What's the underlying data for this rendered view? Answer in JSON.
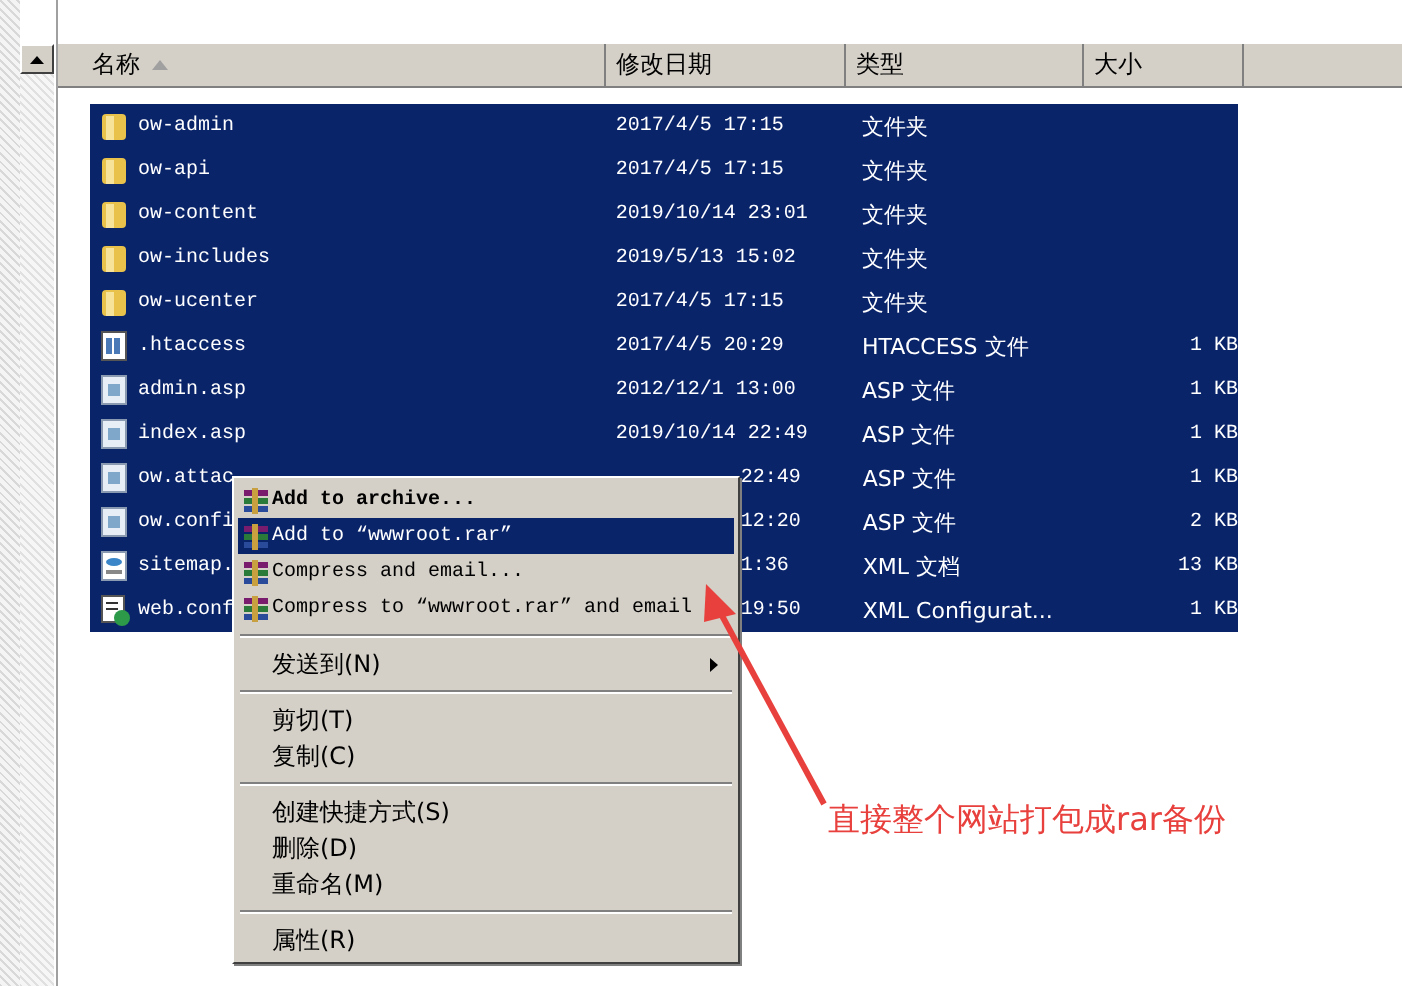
{
  "columns": [
    {
      "label": "名称",
      "sorted": true
    },
    {
      "label": "修改日期",
      "sorted": false
    },
    {
      "label": "类型",
      "sorted": false
    },
    {
      "label": "大小",
      "sorted": false
    }
  ],
  "rows": [
    {
      "kind": "folder",
      "name": "ow-admin",
      "date": "2017/4/5 17:15",
      "type": "文件夹",
      "selected": true
    },
    {
      "kind": "folder",
      "name": "ow-api",
      "date": "2017/4/5 17:15",
      "type": "文件夹",
      "selected": true
    },
    {
      "kind": "folder",
      "name": "ow-content",
      "date": "2019/10/14 23:01",
      "type": "文件夹",
      "selected": true
    },
    {
      "kind": "folder",
      "name": "ow-includes",
      "date": "2019/5/13 15:02",
      "type": "文件夹",
      "selected": true
    },
    {
      "kind": "folder",
      "name": "ow-ucenter",
      "date": "2017/4/5 17:15",
      "type": "文件夹",
      "selected": true
    },
    {
      "kind": "htaccess",
      "name": ".htaccess",
      "date": "2017/4/5 20:29",
      "type": "HTACCESS 文件",
      "size": "1 KB",
      "selected": true
    },
    {
      "kind": "asp",
      "name": "admin.asp",
      "date": "2012/12/1 13:00",
      "type": "ASP 文件",
      "size": "1 KB",
      "selected": true
    },
    {
      "kind": "asp",
      "name": "index.asp",
      "date": "2019/10/14 22:49",
      "type": "ASP 文件",
      "size": "1 KB",
      "selected": true
    },
    {
      "kind": "asp",
      "name": "ow.attac",
      "date": "22:49",
      "date_covered": true,
      "type": "ASP 文件",
      "size": "1 KB",
      "selected": true
    },
    {
      "kind": "asp",
      "name": "ow.confi",
      "date": "12:20",
      "date_covered": true,
      "type": "ASP 文件",
      "size": "2 KB",
      "selected": true
    },
    {
      "kind": "xml",
      "name": "sitemap.",
      "date": "1:36",
      "date_covered": true,
      "type": "XML 文档",
      "size": "13 KB",
      "selected": true
    },
    {
      "kind": "config",
      "name": "web.conf",
      "date": "19:50",
      "date_covered": true,
      "type": "XML Configurat...",
      "size": "1 KB",
      "selected": true
    }
  ],
  "context_menu": {
    "items": [
      {
        "kind": "archive",
        "label": "Add to archive...",
        "bold": true,
        "selected": false
      },
      {
        "kind": "archive",
        "label": "Add to “wwwroot.rar”",
        "bold": false,
        "selected": true
      },
      {
        "kind": "archive",
        "label": "Compress and email...",
        "bold": false,
        "selected": false
      },
      {
        "kind": "archive",
        "label": "Compress to “wwwroot.rar” and email",
        "bold": false,
        "selected": false
      },
      {
        "kind": "separator"
      },
      {
        "kind": "command",
        "label": "发送到(N)",
        "submenu": true,
        "selected": false
      },
      {
        "kind": "separator"
      },
      {
        "kind": "command",
        "label": "剪切(T)",
        "selected": false
      },
      {
        "kind": "command",
        "label": "复制(C)",
        "selected": false
      },
      {
        "kind": "separator"
      },
      {
        "kind": "command",
        "label": "创建快捷方式(S)",
        "selected": false
      },
      {
        "kind": "command",
        "label": "删除(D)",
        "selected": false
      },
      {
        "kind": "command",
        "label": "重命名(M)",
        "selected": false
      },
      {
        "kind": "separator"
      },
      {
        "kind": "command",
        "label": "属性(R)",
        "selected": false
      }
    ]
  },
  "annotation": {
    "text": "直接整个网站打包成rar备份"
  }
}
